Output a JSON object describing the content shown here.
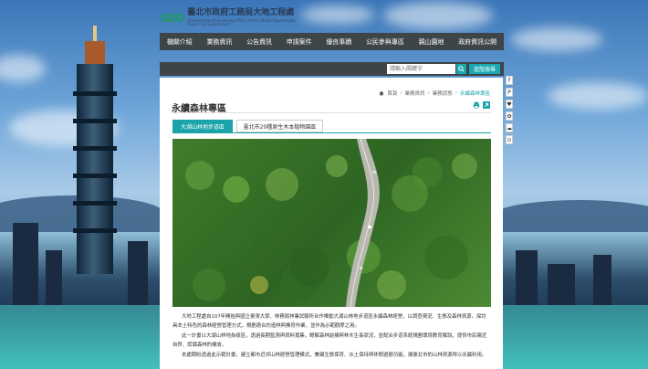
{
  "logo": {
    "mark": "GEO",
    "chinese": "臺北市政府工務局大地工程處",
    "english": "Geotechnical Engineering Office, Public Works Department, Taipei City Government"
  },
  "nav": {
    "items": [
      "機關介紹",
      "業務資訊",
      "公告資訊",
      "申請案件",
      "優良事蹟",
      "公民參與專區",
      "親山園地",
      "政府資訊公開"
    ]
  },
  "search": {
    "placeholder": "請輸入關鍵字",
    "advanced_label": "進階搜尋"
  },
  "breadcrumb": {
    "items": [
      "首頁",
      "業務資訊",
      "業務狀態"
    ],
    "current": "永續森林專區"
  },
  "page": {
    "title": "永續森林專區"
  },
  "tabs": [
    {
      "label": "大湖山林地步道區",
      "active": true
    },
    {
      "label": "臺北市20種原生木本植物園區",
      "active": false
    }
  ],
  "content": {
    "paragraphs": [
      "大地工程處自107年開始與國立臺灣大學、林務局林業試驗所合作推動大湖山林地步道區永續森林經營，以調查現況、生態及森林資源，探討具本土特色的森林經營管理方式，規劃適合的造林與撫育作業，並作為示範觀摩之用。",
      "此一計畫以大湖山林地為樣區，透過長期監測與資料蒐集，瞭解森林結構與林木生長狀況，並配合步道系統規劃環境教育解說，提供市民親近自然、認識森林的機會。",
      "本處期盼透過此示範計畫，建立都市近郊山林經營管理模式，兼顧生態保育、水土保持與休閒遊憩功能，讓臺北市的山林資源得以永續利用。"
    ]
  },
  "social": [
    "f",
    "P",
    "♥",
    "✿",
    "☁",
    "⊙"
  ]
}
